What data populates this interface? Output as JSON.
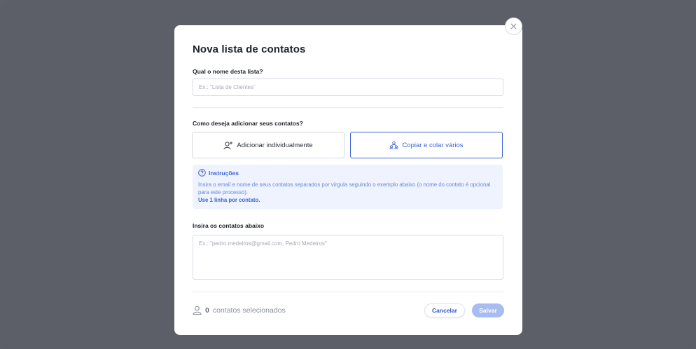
{
  "modal": {
    "title": "Nova lista de contatos",
    "name_label": "Qual o nome desta lista?",
    "name_placeholder": "Ex.: \"Lista de Clientes\"",
    "method_label": "Como deseja adicionar seus contatos?",
    "options": [
      {
        "label": "Adicionar individualmente",
        "icon": "user-plus-icon",
        "selected": false
      },
      {
        "label": "Copiar e colar vários",
        "icon": "group-icon",
        "selected": true
      }
    ],
    "instructions": {
      "title": "Instruções",
      "text": "Insira o email e nome de seus contatos separados por vírgula seguindo o exemplo abaixo (o nome do contato é opcional para este processo).",
      "emphasis": "Use 1 linha por contato."
    },
    "contacts_label": "Insira os contatos abaixo",
    "contacts_placeholder": "Ex.: \"pedro.medeiros@gmail.com, Pedro Medeiros\"",
    "footer": {
      "count": "0",
      "count_label": "contatos selecionados",
      "cancel": "Cancelar",
      "save": "Salvar"
    }
  },
  "colors": {
    "accent": "#3d64d6",
    "save_disabled": "#a9bcf1",
    "backdrop": "#5c5f68",
    "info_bg": "#eef3fe"
  }
}
